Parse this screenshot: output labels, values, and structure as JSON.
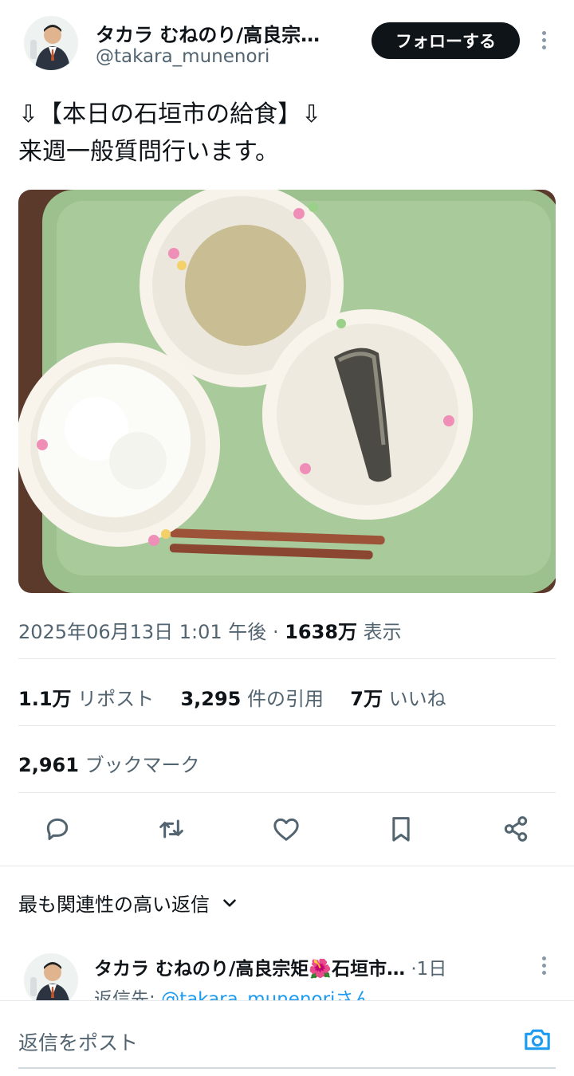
{
  "tweet": {
    "author_name": "タカラ むねのり/高良宗…",
    "handle": "@takara_munenori",
    "follow_label": "フォローする",
    "text_line1": "⇩【本日の石垣市の給食】⇩",
    "text_line2": "来週一般質問行います。",
    "timestamp": "2025年06月13日 1:01 午後",
    "separator": "·",
    "views_count": "1638万",
    "views_label": "表示"
  },
  "stats": {
    "reposts_count": "1.1万",
    "reposts_label": "リポスト",
    "quotes_count": "3,295",
    "quotes_label": "件の引用",
    "likes_count": "7万",
    "likes_label": "いいね",
    "bookmarks_count": "2,961",
    "bookmarks_label": "ブックマーク"
  },
  "actions": [
    "reply-icon",
    "repost-icon",
    "like-icon",
    "bookmark-icon",
    "share-icon"
  ],
  "replies": {
    "sort_label": "最も関連性の高い返信",
    "first_reply": {
      "author_name": "タカラ むねのり/高良宗矩",
      "author_emoji": "🌺",
      "author_suffix": "石垣市…",
      "time": "·1日",
      "reply_to_prefix": "返信先:",
      "reply_to_handle": "@takara_munenoriさん"
    }
  },
  "composer": {
    "placeholder": "返信をポスト"
  },
  "colors": {
    "accent": "#1d9bf0",
    "text": "#0f1419",
    "muted": "#536471",
    "divider": "#e5e9ec"
  }
}
